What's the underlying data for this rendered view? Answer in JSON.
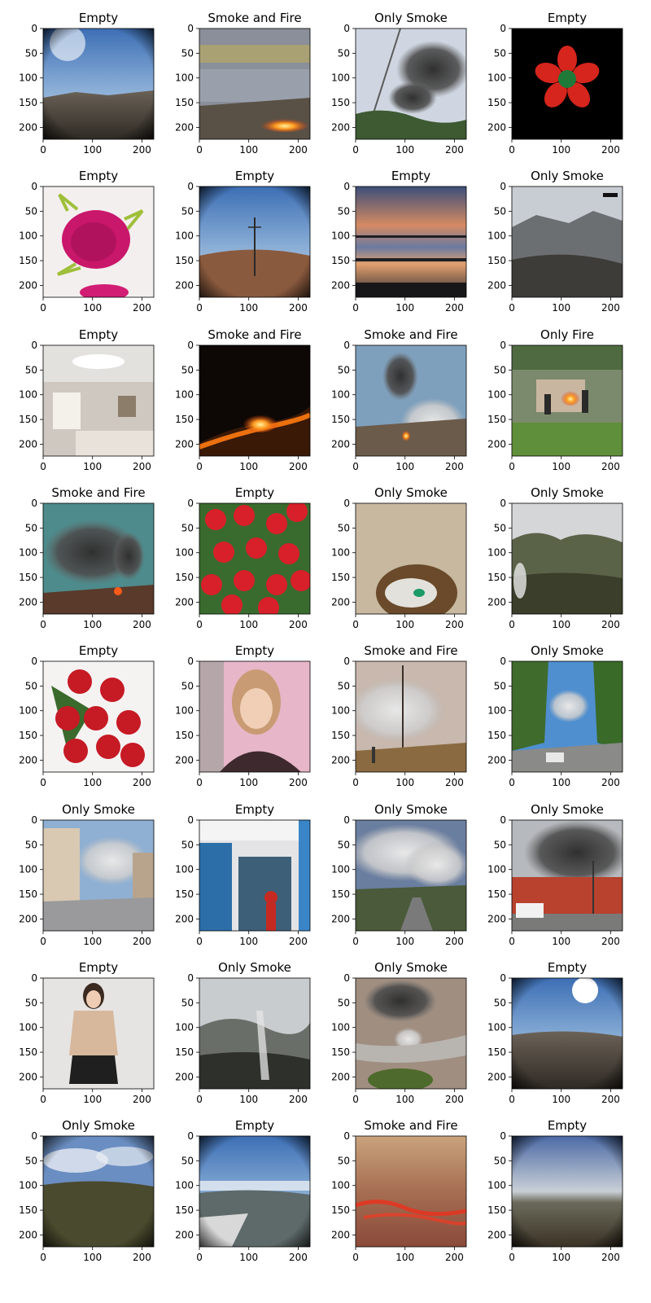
{
  "figure": {
    "rows": 8,
    "cols": 4,
    "x_ticks": [
      "0",
      "100",
      "200"
    ],
    "y_ticks": [
      "0",
      "50",
      "100",
      "150",
      "200"
    ],
    "panels": [
      {
        "title": "Empty",
        "scene": "sky-fisheye"
      },
      {
        "title": "Smoke and Fire",
        "scene": "grass-fire"
      },
      {
        "title": "Only Smoke",
        "scene": "smoke-column"
      },
      {
        "title": "Empty",
        "scene": "strawberry-flower"
      },
      {
        "title": "Empty",
        "scene": "dragon-fruit"
      },
      {
        "title": "Empty",
        "scene": "tower-fisheye"
      },
      {
        "title": "Empty",
        "scene": "sunset"
      },
      {
        "title": "Only Smoke",
        "scene": "mountain-gray"
      },
      {
        "title": "Empty",
        "scene": "bedroom"
      },
      {
        "title": "Smoke and Fire",
        "scene": "night-fire"
      },
      {
        "title": "Smoke and Fire",
        "scene": "smoke-fire-plume"
      },
      {
        "title": "Only Fire",
        "scene": "firefighters"
      },
      {
        "title": "Smoke and Fire",
        "scene": "dark-smoke-fire"
      },
      {
        "title": "Empty",
        "scene": "roses"
      },
      {
        "title": "Only Smoke",
        "scene": "blurry-smoke"
      },
      {
        "title": "Only Smoke",
        "scene": "mountain-smoke"
      },
      {
        "title": "Empty",
        "scene": "rose-bouquet"
      },
      {
        "title": "Empty",
        "scene": "portrait"
      },
      {
        "title": "Smoke and Fire",
        "scene": "pole-smoke"
      },
      {
        "title": "Only Smoke",
        "scene": "street-smoke"
      },
      {
        "title": "Only Smoke",
        "scene": "town-smoke"
      },
      {
        "title": "Empty",
        "scene": "shop"
      },
      {
        "title": "Only Smoke",
        "scene": "city-smoke"
      },
      {
        "title": "Only Smoke",
        "scene": "black-smoke-building"
      },
      {
        "title": "Empty",
        "scene": "uniform-woman"
      },
      {
        "title": "Only Smoke",
        "scene": "foggy-valley"
      },
      {
        "title": "Only Smoke",
        "scene": "road-smoke"
      },
      {
        "title": "Empty",
        "scene": "sun-fisheye"
      },
      {
        "title": "Only Smoke",
        "scene": "cloudy-hills"
      },
      {
        "title": "Empty",
        "scene": "valley-fisheye"
      },
      {
        "title": "Smoke and Fire",
        "scene": "orange-fire"
      },
      {
        "title": "Empty",
        "scene": "dusk-fisheye"
      }
    ]
  },
  "colors": {
    "axis": "#000000",
    "background": "#ffffff"
  }
}
